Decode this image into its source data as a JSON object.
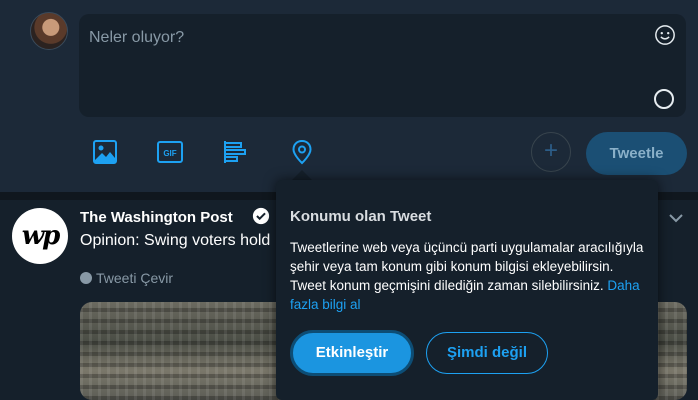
{
  "composer": {
    "placeholder": "Neler oluyor?",
    "tweet_button": "Tweetle",
    "plus": "+"
  },
  "toolbar": {
    "icons": [
      "image-icon",
      "gif-icon",
      "poll-icon",
      "location-icon"
    ],
    "gif_label": "GIF"
  },
  "tweet": {
    "logo": "wp",
    "author": "The Washington Post",
    "text": "Opinion: Swing voters hold",
    "translate": "Tweeti Çevir"
  },
  "popover": {
    "title": "Konumu olan Tweet",
    "body": "Tweetlerine web veya üçüncü parti uygulamalar aracılığıyla şehir veya tam konum gibi konum bilgisi ekleyebilirsin. Tweet konum geçmişini dilediğin zaman silebilirsiniz.",
    "link": "Daha fazla bilgi al",
    "primary_button": "Etkinleştir",
    "secondary_button": "Şimdi değil"
  },
  "colors": {
    "accent": "#1da1f2",
    "background": "#15202b",
    "composer_bg": "#1c2938"
  }
}
